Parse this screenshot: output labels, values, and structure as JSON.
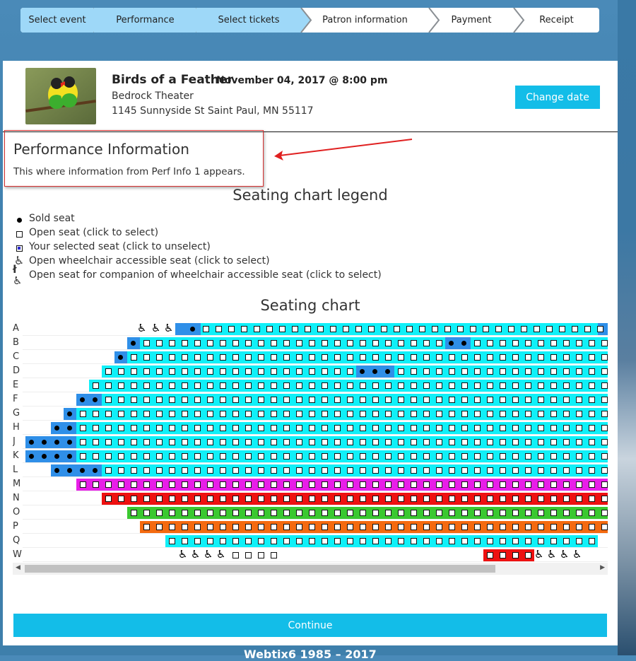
{
  "steps": [
    "Select event",
    "Performance",
    "Select tickets",
    "Patron information",
    "Payment",
    "Receipt"
  ],
  "event": {
    "title": "Birds of a Feather",
    "date": "November 04, 2017 @ 8:00 pm",
    "venue": "Bedrock Theater",
    "address": "1145 Sunnyside St Saint Paul, MN 55117",
    "change_date_label": "Change date"
  },
  "perf_info": {
    "title": "Performance Information",
    "text": "This where information from Perf Info 1 appears."
  },
  "legend": {
    "title": "Seating chart legend",
    "items": [
      {
        "icon": "sold-seat-icon",
        "label": "Sold seat"
      },
      {
        "icon": "open-seat-icon",
        "label": "Open seat (click to select)"
      },
      {
        "icon": "selected-seat-icon",
        "label": "Your selected seat (click to unselect)"
      },
      {
        "icon": "wheelchair-seat-icon",
        "label": "Open wheelchair accessible seat (click to select)"
      },
      {
        "icon": "companion-seat-icon",
        "label": "Open seat for companion of wheelchair accessible seat (click to select)"
      }
    ]
  },
  "chart": {
    "title": "Seating chart",
    "rows": [
      "A",
      "B",
      "C",
      "D",
      "E",
      "F",
      "G",
      "H",
      "J",
      "K",
      "L",
      "M",
      "N",
      "O",
      "P",
      "Q",
      "W"
    ]
  },
  "colors": {
    "accent": "#13bde8",
    "cyan": "#10f0f8",
    "blue": "#2f8fe8",
    "magenta": "#e81ee8",
    "red": "#ee1111",
    "green": "#3ac830",
    "orange": "#f46a10",
    "steps_done": "#9ed8f8"
  },
  "continue_label": "Continue",
  "footer": "Webtix6 1985 – 2017"
}
